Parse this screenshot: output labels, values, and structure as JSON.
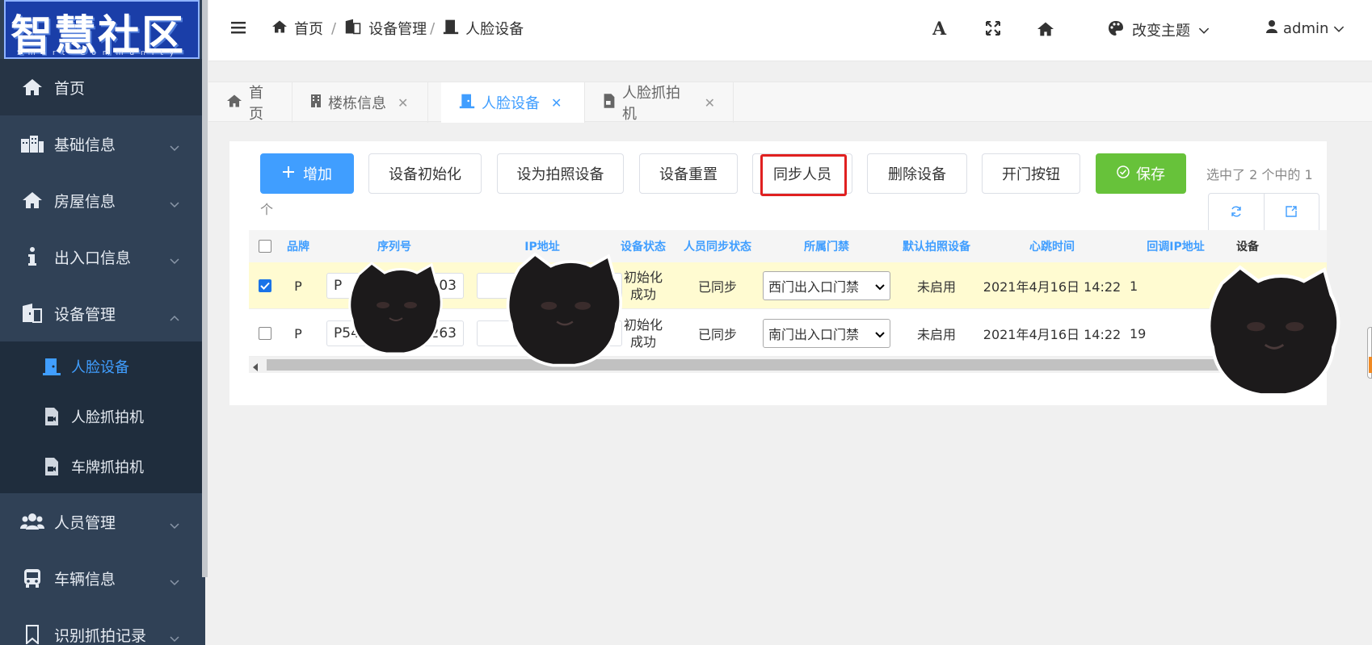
{
  "logo": {
    "title": "智慧社区",
    "subtitle": "Smart Community"
  },
  "sidebar": {
    "items": [
      {
        "label": "首页",
        "icon": "home-icon"
      },
      {
        "label": "基础信息",
        "icon": "building-icon"
      },
      {
        "label": "房屋信息",
        "icon": "home-icon"
      },
      {
        "label": "出入口信息",
        "icon": "info-icon"
      },
      {
        "label": "设备管理",
        "icon": "door-building-icon"
      },
      {
        "label": "人员管理",
        "icon": "users-icon"
      },
      {
        "label": "车辆信息",
        "icon": "bus-icon"
      },
      {
        "label": "识别抓拍记录",
        "icon": "bookmark-icon"
      }
    ],
    "subitems": [
      {
        "label": "人脸设备",
        "icon": "door-icon"
      },
      {
        "label": "人脸抓拍机",
        "icon": "camera-file-icon"
      },
      {
        "label": "车牌抓拍机",
        "icon": "camera-file-icon"
      }
    ]
  },
  "header": {
    "breadcrumb": [
      "首页",
      "设备管理",
      "人脸设备"
    ],
    "theme_label": "改变主题",
    "user_label": "admin"
  },
  "tabs": [
    {
      "label": "首页"
    },
    {
      "label": "楼栋信息"
    },
    {
      "label": "人脸设备"
    },
    {
      "label": "人脸抓拍机"
    }
  ],
  "toolbar": {
    "add_label": "增加",
    "init_label": "设备初始化",
    "set_photo_label": "设为拍照设备",
    "reset_label": "设备重置",
    "sync_label": "同步人员",
    "delete_label": "删除设备",
    "open_door_label": "开门按钮",
    "save_label": "保存",
    "selection_text": "选中了 2 个中的 1",
    "selection_text_cont": "个"
  },
  "table": {
    "headers": [
      "品牌",
      "序列号",
      "IP地址",
      "设备状态",
      "人员同步状态",
      "所属门禁",
      "默认拍照设备",
      "心跳时间",
      "回调IP地址",
      "设备"
    ],
    "rows": [
      {
        "brand": "P",
        "serial": "P",
        "serial_tail": "R103",
        "ip": "",
        "status": "初始化\n成功",
        "sync": "已同步",
        "door": "西门出入口门禁",
        "default_photo": "未启用",
        "heartbeat": "2021年4月16日 14:22",
        "callback": "1",
        "checked": true
      },
      {
        "brand": "P",
        "serial": "P54",
        "serial_tail": "0CN263",
        "ip": "90",
        "status": "初始化\n成功",
        "sync": "已同步",
        "door": "南门出入口门禁",
        "default_photo": "未启用",
        "heartbeat": "2021年4月16日 14:22",
        "callback": "19",
        "checked": false
      }
    ]
  },
  "colors": {
    "sidebar_bg": "#304156",
    "accent": "#409eff",
    "success": "#67c23a",
    "highlight": "#e02020"
  }
}
